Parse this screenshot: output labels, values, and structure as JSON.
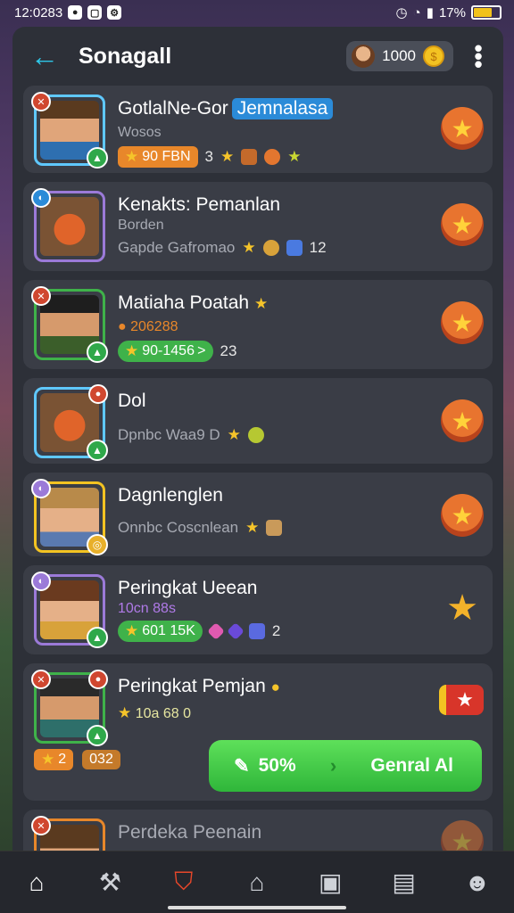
{
  "status": {
    "time": "12:0283",
    "battery_text": "17%",
    "battery_level": 0.7
  },
  "header": {
    "title": "Sonagall",
    "coins": "1000"
  },
  "rows": [
    {
      "name": "GotlalNe-Gor",
      "tag": "Jemnalasa",
      "sub": "Wosos",
      "pill_text": "90 FBN",
      "extra": "3"
    },
    {
      "name": "Kenakts: Pemanlan",
      "sub": "Borden",
      "line": "Gapde Gafromao",
      "count": "12"
    },
    {
      "name": "Matiaha Poatah",
      "sub": "206288",
      "pill_text": "90-1456 >",
      "extra": "23"
    },
    {
      "name": "Dol",
      "line": "Dpnbc Waa9 D"
    },
    {
      "name": "Dagnlenglen",
      "line": "Onnbc Coscnlean"
    },
    {
      "name": "Peringkat Ueean",
      "sub": "10cn 88s",
      "pill_text": "601 15K",
      "extra": "2"
    },
    {
      "name": "Peringkat Pemjan",
      "sub": "10a 68 0",
      "pill_left": "2",
      "pill_right": "032",
      "cta_left": "50%",
      "cta_right": "Genral Al"
    },
    {
      "name": "Perdeka Peenain"
    }
  ]
}
